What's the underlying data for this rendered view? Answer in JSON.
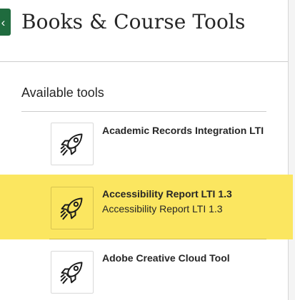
{
  "header": {
    "close_glyph": "‹",
    "title": "Books & Course Tools"
  },
  "section": {
    "heading": "Available tools"
  },
  "tools": [
    {
      "name": "Academic Records Integration LTI",
      "description": "",
      "icon": "rocket-icon",
      "highlighted": false
    },
    {
      "name": "Accessibility Report LTI 1.3",
      "description": "Accessibility Report LTI 1.3",
      "icon": "rocket-icon",
      "highlighted": true
    },
    {
      "name": "Adobe Creative Cloud Tool",
      "description": "",
      "icon": "rocket-icon",
      "highlighted": false
    }
  ],
  "colors": {
    "close_tab": "#1f6b3e",
    "highlight": "#fbe660",
    "text": "#262626",
    "divider": "#cdcdcd"
  }
}
